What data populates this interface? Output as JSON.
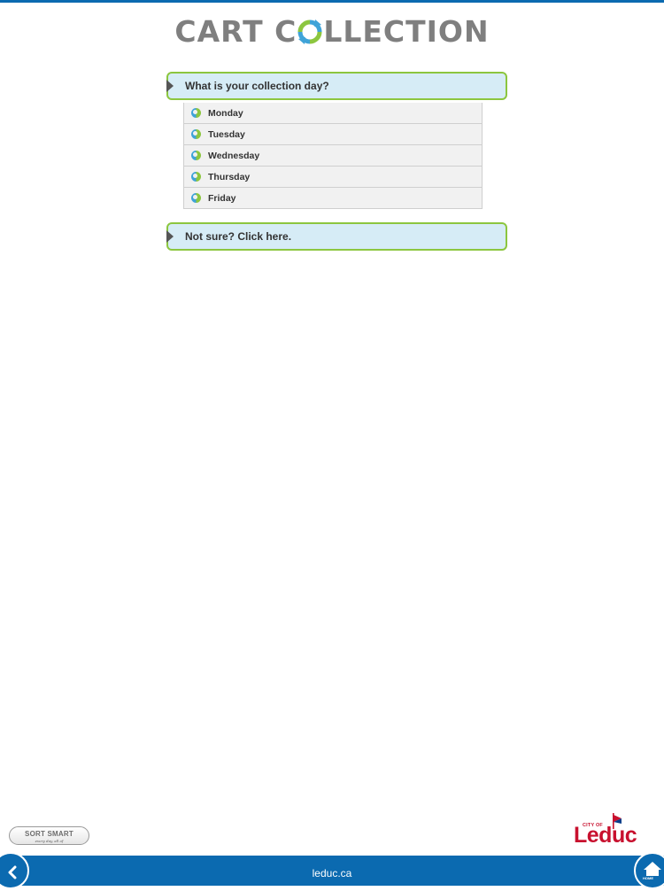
{
  "header": {
    "title_before": "CART C",
    "title_after": "LLECTION",
    "title_icon": "recycle-o-icon"
  },
  "question_panel": {
    "label": "What is your collection day?"
  },
  "days": [
    {
      "label": "Monday"
    },
    {
      "label": "Tuesday"
    },
    {
      "label": "Wednesday"
    },
    {
      "label": "Thursday"
    },
    {
      "label": "Friday"
    }
  ],
  "not_sure_panel": {
    "label": "Not sure? Click here."
  },
  "bottom": {
    "sort_smart_label": "SORT SMART",
    "sort_smart_tagline": "every day, all of",
    "logo_small": "CITY OF",
    "logo_word": "Leduc"
  },
  "footer": {
    "site": "leduc.ca",
    "home_label": "HOME",
    "back_icon": "chevron-left-icon",
    "home_icon": "house-icon"
  },
  "colors": {
    "brand_blue": "#0b6ab0",
    "accent_green": "#8cc63f",
    "panel_blue": "#d6ecf6",
    "logo_red": "#c8102e"
  }
}
